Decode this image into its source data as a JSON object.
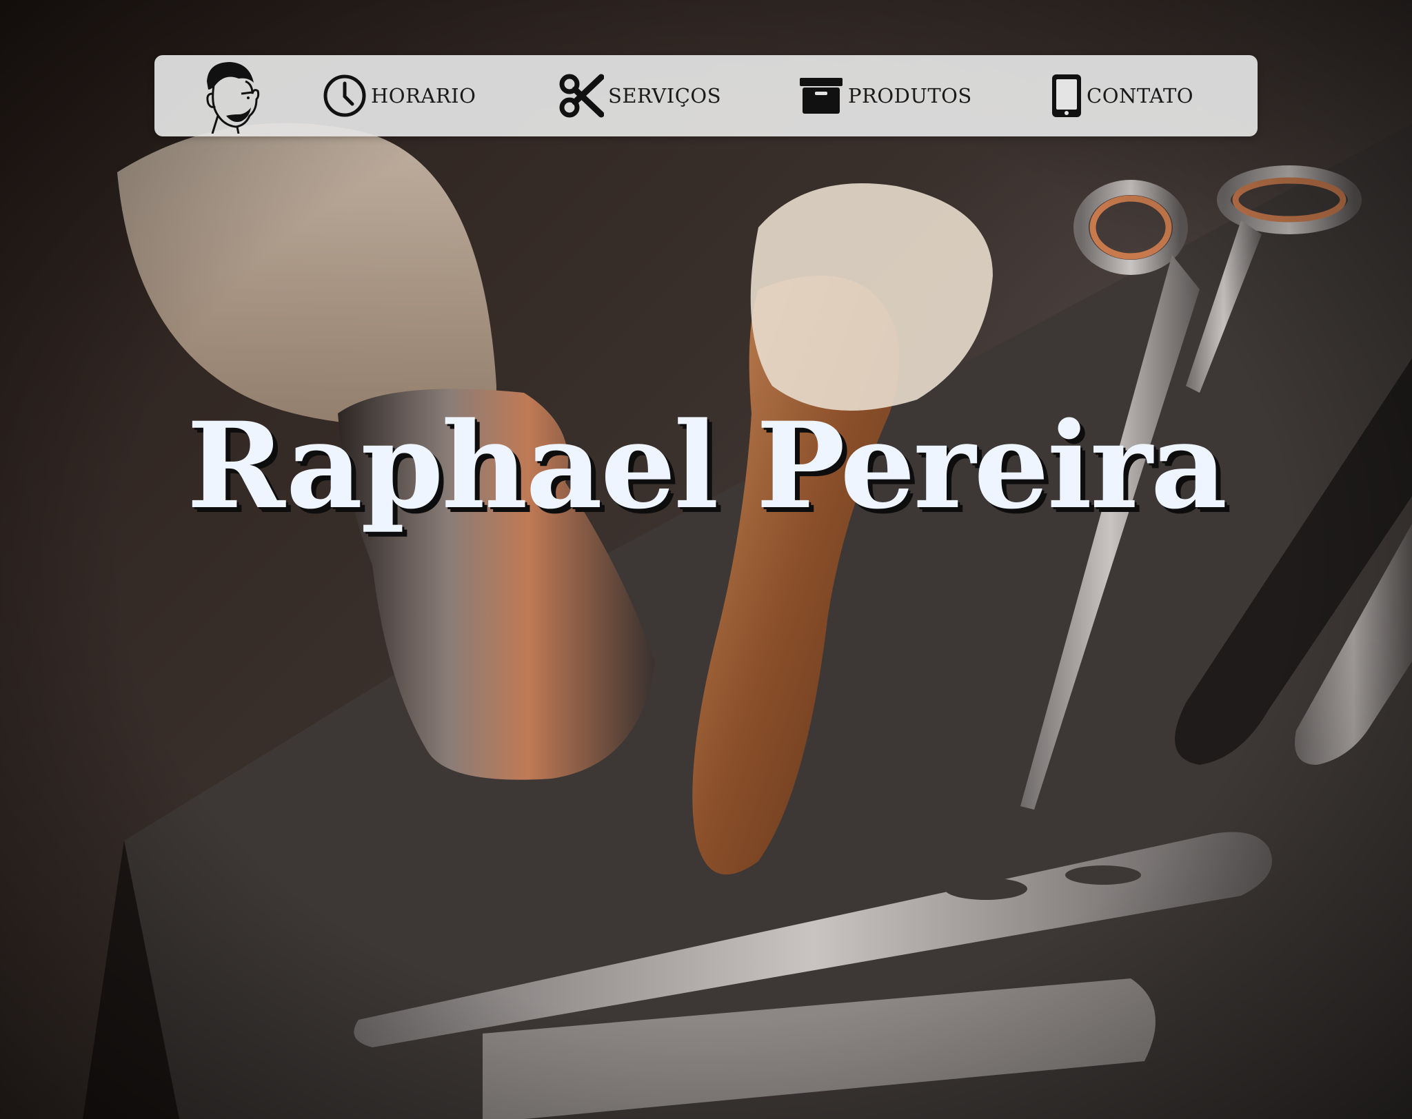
{
  "nav": {
    "logo_name": "barber-face-logo",
    "items": [
      {
        "icon": "clock-icon",
        "label": "HORARIO"
      },
      {
        "icon": "scissors-icon",
        "label": "SERVIÇOS"
      },
      {
        "icon": "archive-box-icon",
        "label": "PRODUTOS"
      },
      {
        "icon": "smartphone-icon",
        "label": "CONTATO"
      }
    ]
  },
  "hero": {
    "title": "Raphael Pereira"
  },
  "colors": {
    "nav_background": "#e4e4e4",
    "nav_text": "#1a1a1a",
    "title_text": "#eef5ff",
    "title_shadow": "#0d0d0d"
  }
}
